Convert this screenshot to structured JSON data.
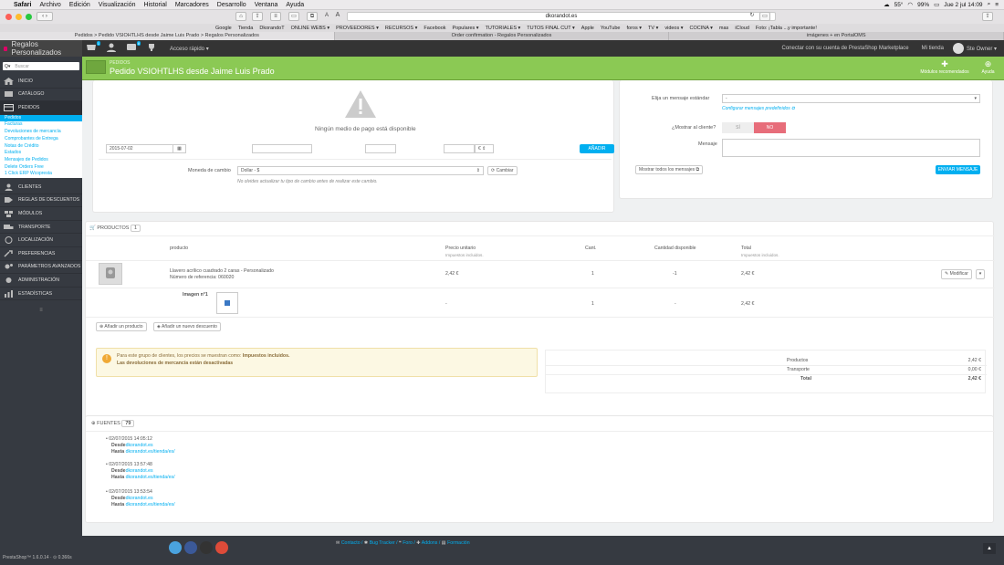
{
  "menubar": {
    "apple": "",
    "items": [
      "Safari",
      "Archivo",
      "Edición",
      "Visualización",
      "Historial",
      "Marcadores",
      "Desarrollo",
      "Ventana",
      "Ayuda"
    ],
    "status": {
      "temp": "55°",
      "battery": "99%",
      "datetime": "Jue 2 jul 14:09"
    }
  },
  "browser": {
    "url": "dkorandot.es",
    "font_small": "A",
    "font_big": "A",
    "bookmarks": [
      "Google",
      "Tienda",
      "DkorandoT",
      "ONLINE WEBS ▾",
      "PROVEEDORES ▾",
      "RECURSOS ▾",
      "Facebook",
      "Populares ▾",
      "TUTORIALES ▾",
      "TUTOS FINAL CUT ▾",
      "Apple",
      "YouTube",
      "foros ▾",
      "TV ▾",
      "videos ▾",
      "COCINA ▾",
      "mas",
      "iCloud",
      "Foto: ¡Tabla ...y importante!"
    ],
    "tabs": [
      {
        "label": "Pedidos > Pedido VSIOHTLHS desde Jaime Luis Prado > Regalos Personalizados",
        "active": true
      },
      {
        "label": "Order confirmation - Regalos Personalizados",
        "active": false
      },
      {
        "label": "imágenes + en PortalOMS",
        "active": false
      }
    ]
  },
  "header": {
    "shop_name": "Regalos Personalizados",
    "badges": [
      "1",
      "",
      "8"
    ],
    "quick_access": "Acceso rápido ▾",
    "connect": "Conectar con su cuenta de PrestaShop Marketplace",
    "my_shop": "Mi tienda",
    "user": "Ste Owner ▾"
  },
  "sidebar": {
    "search_placeholder": "Buscar",
    "items": [
      {
        "label": "INICIO",
        "icon": "home-icon"
      },
      {
        "label": "CATÁLOGO",
        "icon": "catalog-icon"
      },
      {
        "label": "PEDIDOS",
        "icon": "orders-icon"
      }
    ],
    "subitems": [
      {
        "label": "Pedidos",
        "active": true
      },
      {
        "label": "Facturas"
      },
      {
        "label": "Devoluciones de mercancía"
      },
      {
        "label": "Comprobantes de Entrega"
      },
      {
        "label": "Notas de Crédito"
      },
      {
        "label": "Estados"
      },
      {
        "label": "Mensajes de Pedidos"
      },
      {
        "label": "Delete Orders Free"
      },
      {
        "label": "1 Click ERP Wcopresta"
      }
    ],
    "items2": [
      {
        "label": "CLIENTES",
        "icon": "customers-icon"
      },
      {
        "label": "REGLAS DE DESCUENTOS",
        "icon": "discount-icon"
      },
      {
        "label": "MÓDULOS",
        "icon": "modules-icon"
      },
      {
        "label": "TRANSPORTE",
        "icon": "truck-icon"
      },
      {
        "label": "LOCALIZACIÓN",
        "icon": "globe-icon"
      },
      {
        "label": "PREFERENCIAS",
        "icon": "wrench-icon"
      },
      {
        "label": "PARÁMETROS AVANZADOS",
        "icon": "gears-icon"
      },
      {
        "label": "ADMINISTRACIÓN",
        "icon": "admin-icon"
      },
      {
        "label": "ESTADÍSTICAS",
        "icon": "stats-icon"
      }
    ],
    "footer": "PrestaShop™ 1.6.0.14 · ⊙ 0.366s"
  },
  "page": {
    "breadcrumb": "PEDIDOS",
    "title": "Pedido VSIOHTLHS desde Jaime Luis Prado",
    "tool_modules": "Módulos recomendados",
    "tool_help": "Ayuda"
  },
  "payment": {
    "no_method": "Ningún medio de pago está disponible",
    "date": "2015-07-02",
    "currency_symbol": "€",
    "add_button": "AÑADIR",
    "currency_label": "Moneda de cambio",
    "currency_value": "Dollar - $",
    "change_button": "Cambiar",
    "hint": "No olvides actualizar tu tipo de cambio antes de realizar este cambio."
  },
  "messages": {
    "choose_label": "Elija un mensaje estándar",
    "choose_value": "-",
    "configure_link": "Configurar mensajes predefinidos",
    "show_label": "¿Mostrar al cliente?",
    "yes": "SÍ",
    "no": "NO",
    "message_label": "Mensaje",
    "show_all": "Mostrar todos los mensajes",
    "send": "ENVIAR MENSAJE"
  },
  "products": {
    "heading": "PRODUCTOS",
    "count": "1",
    "columns": [
      {
        "label": "producto",
        "sub": ""
      },
      {
        "label": "Precio unitario",
        "sub": "Impuestos incluidos."
      },
      {
        "label": "Cant.",
        "sub": ""
      },
      {
        "label": "Cantidad disponible",
        "sub": ""
      },
      {
        "label": "Total",
        "sub": "Impuestos incluidos."
      }
    ],
    "rows": [
      {
        "name": "Llavero acrílico cuadrado 2 caras - Personalizado",
        "ref": "Número de referencia: 060020",
        "price": "2,42 €",
        "qty": "1",
        "avail": "-1",
        "total": "2,42 €",
        "action": "Modificar"
      },
      {
        "name": "Imagen n°1",
        "price": "-",
        "qty": "1",
        "avail": "-",
        "total": "2,42 €"
      }
    ],
    "add_product": "Añadir un producto",
    "add_discount": "Añadir un nuevo descuento",
    "notice_line1": "Para este grupo de clientes, los precios se muestran como: ",
    "notice_strong": "Impuestos incluidos.",
    "notice_line2": "Las devoluciones de mercancía están desactivadas",
    "summary": [
      {
        "label": "Productos",
        "value": "2,42 €"
      },
      {
        "label": "Transporte",
        "value": "0,00 €"
      },
      {
        "label": "Total",
        "value": "2,42 €"
      }
    ]
  },
  "sources": {
    "heading": "FUENTES",
    "count": "79",
    "items": [
      {
        "date": "02/07/2015 14:05:12",
        "from_label": "Desde",
        "from": "dkorandot.es",
        "to_label": "Hasta",
        "to": "dkorandot.es/tienda/es/"
      },
      {
        "date": "02/07/2015 13:57:48",
        "from_label": "Desde",
        "from": "dkorandot.es",
        "to_label": "Hasta",
        "to": "dkorandot.es/tienda/es/"
      },
      {
        "date": "02/07/2015 13:53:54",
        "from_label": "Desde",
        "from": "dkorandot.es",
        "to_label": "Hasta",
        "to": "dkorandot.es/tienda/es/"
      }
    ]
  },
  "footer": {
    "links": [
      "Contacto",
      "Bug Tracker",
      "Foro",
      "Addons",
      "Formación"
    ]
  },
  "colors": {
    "accent": "#00aff0",
    "toolbar_green": "#8bc954",
    "sidebar": "#363a41",
    "warning": "#fcf8e3"
  }
}
